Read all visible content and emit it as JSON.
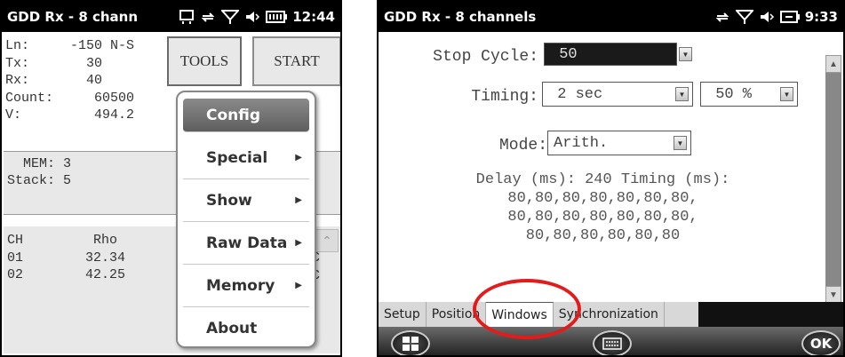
{
  "left": {
    "title": "GDD Rx - 8 chann",
    "time": "12:44",
    "info": [
      {
        "label": "Ln:",
        "value": " -150 N-S"
      },
      {
        "label": "Tx:",
        "value": "   30"
      },
      {
        "label": "Rx:",
        "value": "   40"
      },
      {
        "label": "Count:",
        "value": "    60500"
      },
      {
        "label": "V:",
        "value": "    494.2"
      }
    ],
    "tools_label": "TOOLS",
    "start_label": "START",
    "mem": "  MEM: 3\nStack: 5",
    "table_header": {
      "c1": "CH",
      "c2": "   Rho"
    },
    "table_rows": [
      {
        "c1": "01",
        "c2": "  32.34"
      },
      {
        "c1": "02",
        "c2": "  42.25"
      }
    ],
    "table_cut_suffix": "C",
    "menu": [
      {
        "label": "Config",
        "submenu": false,
        "selected": true
      },
      {
        "label": "Special",
        "submenu": true
      },
      {
        "label": "Show",
        "submenu": true
      },
      {
        "label": "Raw Data",
        "submenu": true
      },
      {
        "label": "Memory",
        "submenu": true
      },
      {
        "label": "About",
        "submenu": false
      }
    ]
  },
  "right": {
    "title": "GDD Rx - 8 channels",
    "time": "9:33",
    "stop_cycle_label": "Stop Cycle:",
    "stop_cycle_value": " 50",
    "timing_label": "Timing:",
    "timing_value": " 2 sec",
    "timing_percent": " 50 %",
    "mode_label": "Mode:",
    "mode_value": "Arith.",
    "delay_lines": [
      "Delay (ms): 240 Timing (ms):",
      "80,80,80,80,80,80,80,",
      "80,80,80,80,80,80,80,",
      "80,80,80,80,80,80"
    ],
    "tabs": [
      "Setup",
      "Position",
      "Windows",
      "Synchronization"
    ],
    "active_tab": "Windows",
    "ok_label": "OK"
  },
  "colors": {
    "annotation": "#e31b1b",
    "titlebar": "#000000"
  }
}
